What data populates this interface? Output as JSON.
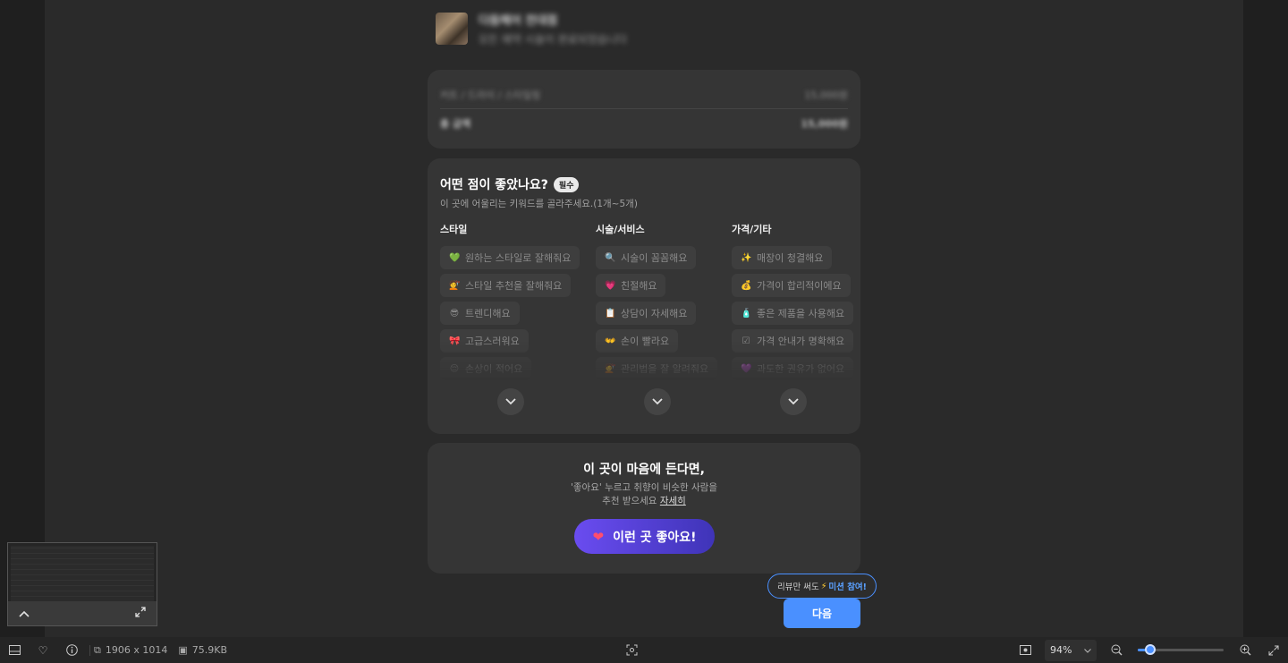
{
  "store": {
    "name": "다듬헤어 전대점",
    "subtitle": "모든 예약 시술이 완료되었습니다"
  },
  "receipt": {
    "row1_label": "커트 / 드라이 / 스타일링",
    "row1_value": "15,000원",
    "row2_label": "총 금액",
    "row2_value": "15,000원"
  },
  "keywords": {
    "title": "어떤 점이 좋았나요?",
    "badge": "필수",
    "subtitle": "이 곳에 어울리는 키워드를 골라주세요.(1개~5개)",
    "columns": [
      {
        "title": "스타일",
        "items": [
          {
            "emoji": "💚",
            "label": "원하는 스타일로 잘해줘요"
          },
          {
            "emoji": "💇",
            "label": "스타일 추천을 잘해줘요"
          },
          {
            "emoji": "😎",
            "label": "트렌디해요"
          },
          {
            "emoji": "🎀",
            "label": "고급스러워요"
          },
          {
            "emoji": "😌",
            "label": "손상이 적어요"
          }
        ]
      },
      {
        "title": "시술/서비스",
        "items": [
          {
            "emoji": "🔍",
            "label": "시술이 꼼꼼해요"
          },
          {
            "emoji": "💗",
            "label": "친절해요"
          },
          {
            "emoji": "📋",
            "label": "상담이 자세해요"
          },
          {
            "emoji": "👐",
            "label": "손이 빨라요"
          },
          {
            "emoji": "💇",
            "label": "관리법을 잘 알려줘요"
          }
        ]
      },
      {
        "title": "가격/기타",
        "items": [
          {
            "emoji": "✨",
            "label": "매장이 청결해요"
          },
          {
            "emoji": "💰",
            "label": "가격이 합리적이에요"
          },
          {
            "emoji": "🧴",
            "label": "좋은 제품을 사용해요"
          },
          {
            "emoji": "☑",
            "label": "가격 안내가 명확해요"
          },
          {
            "emoji": "💜",
            "label": "과도한 권유가 없어요"
          }
        ]
      }
    ]
  },
  "like": {
    "title": "이 곳이 마음에 든다면,",
    "desc_line1": "'좋아요' 누르고 취향이 비슷한 사람을",
    "desc_line2": "추천 받으세요",
    "more": "자세히",
    "button": "이런 곳 좋아요!"
  },
  "mission": {
    "prefix": "리뷰만 써도",
    "highlight": "미션 참여!"
  },
  "next_button": "다음",
  "statusbar": {
    "dimensions": "1906 x 1014",
    "filesize": "75.9KB",
    "zoom": "94%",
    "zoom_fraction": 0.15
  },
  "colors": {
    "accent": "#4a90ff",
    "like_button": "#5a40e0",
    "card": "#353535"
  }
}
